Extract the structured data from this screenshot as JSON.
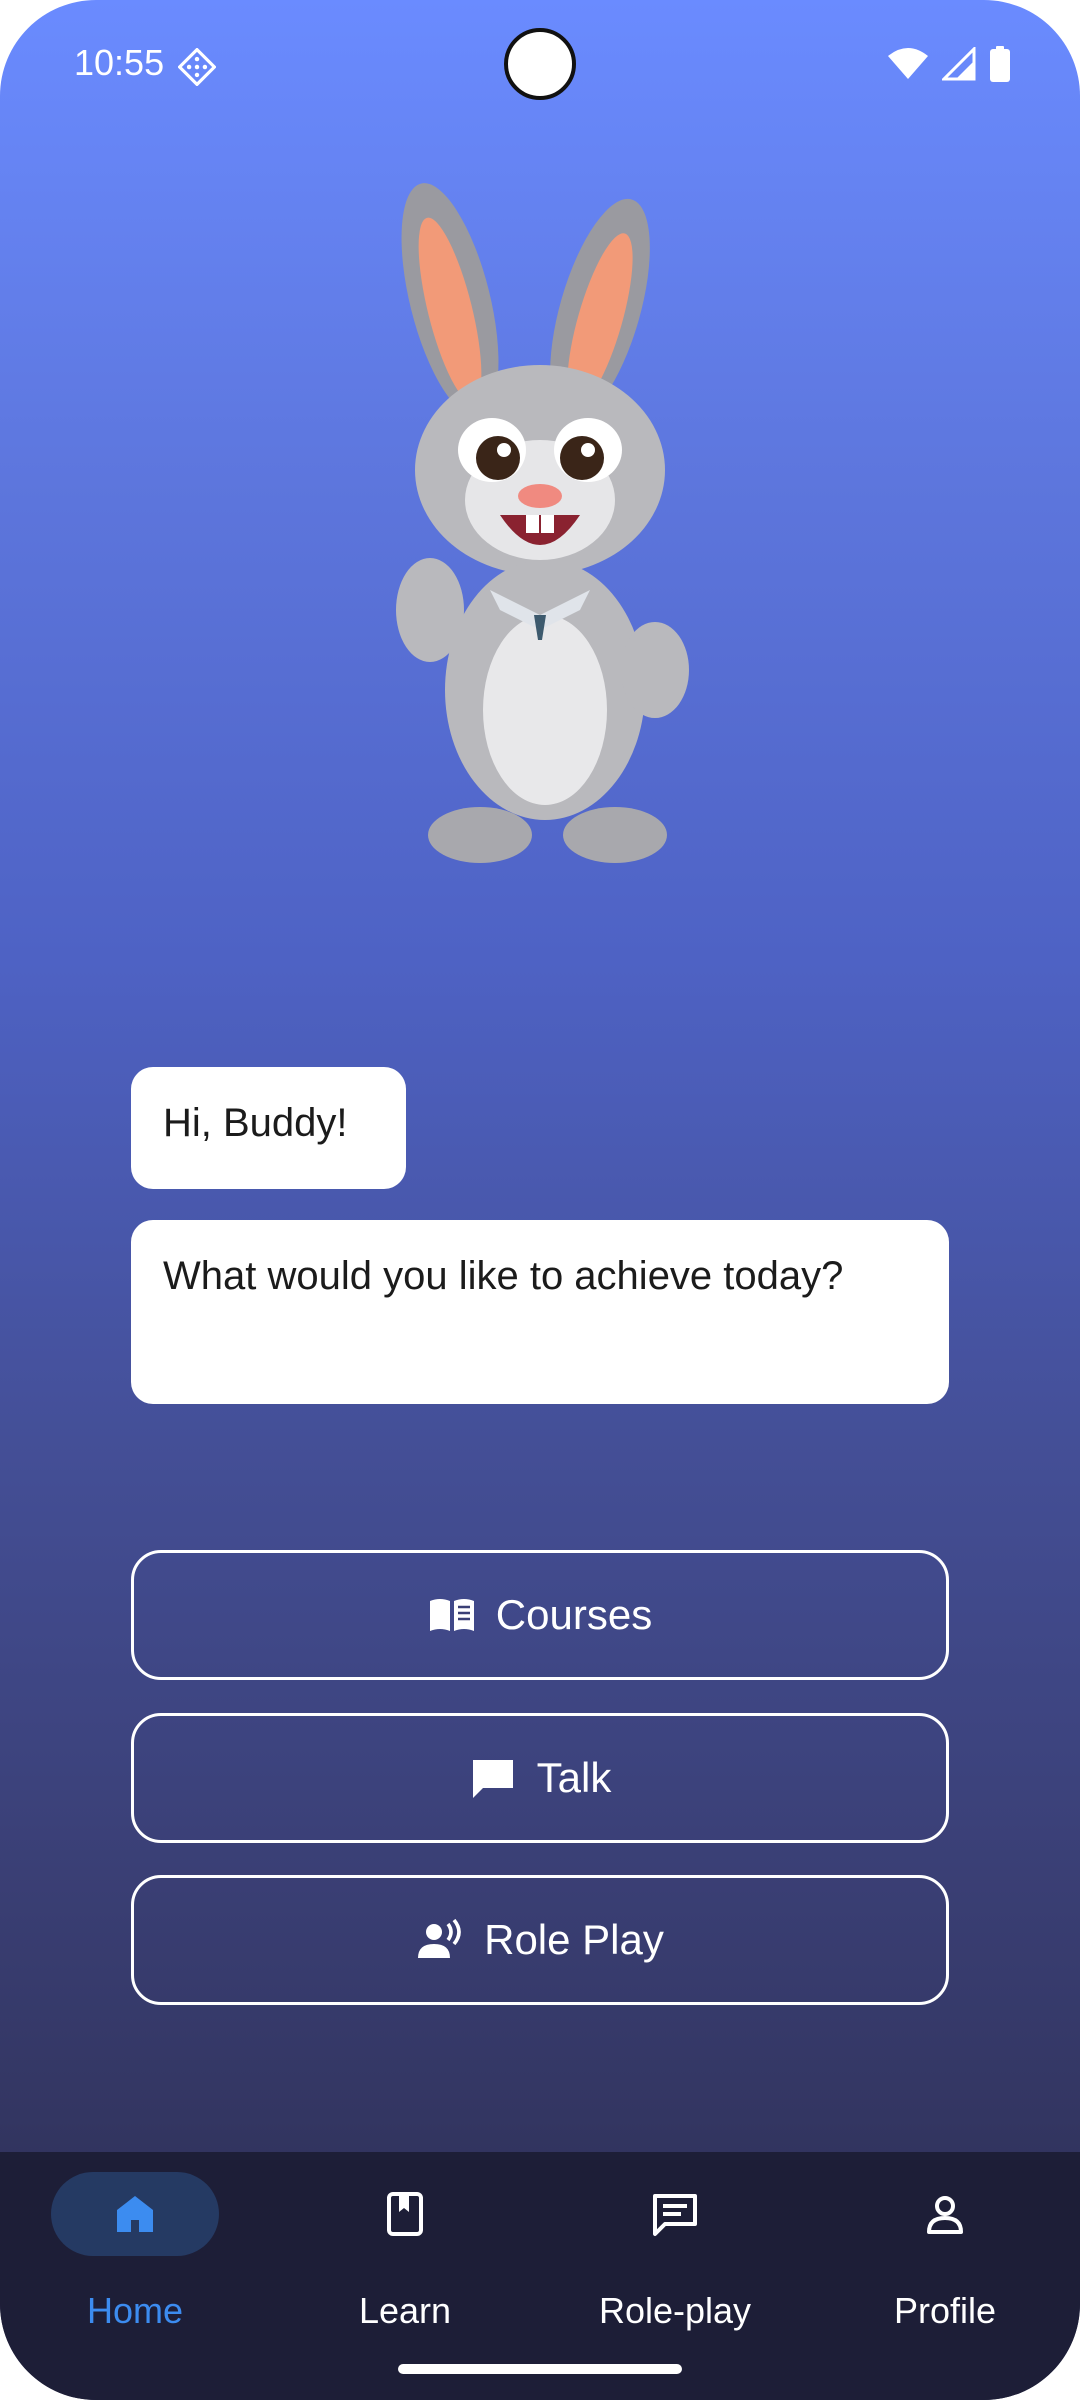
{
  "status_bar": {
    "time": "10:55",
    "app_icon": "diamond-pattern-icon",
    "icons": [
      "wifi-icon",
      "signal-icon",
      "battery-icon"
    ]
  },
  "mascot": {
    "icon": "bunny-mascot-illustration"
  },
  "chat": {
    "greeting": "Hi, Buddy!",
    "question": "What would you like to achieve today?"
  },
  "actions": [
    {
      "label": "Courses",
      "icon": "open-book-icon"
    },
    {
      "label": "Talk",
      "icon": "chat-bubble-icon"
    },
    {
      "label": "Role Play",
      "icon": "speaking-person-icon"
    }
  ],
  "nav": {
    "items": [
      {
        "label": "Home",
        "icon": "home-icon",
        "active": true
      },
      {
        "label": "Learn",
        "icon": "bookmark-book-icon",
        "active": false
      },
      {
        "label": "Role-play",
        "icon": "chat-lines-icon",
        "active": false
      },
      {
        "label": "Profile",
        "icon": "person-icon",
        "active": false
      }
    ]
  },
  "colors": {
    "gradient_top": "#6a8bff",
    "gradient_bottom": "#2b2b4c",
    "nav_background": "#1d1e37",
    "active_accent": "#3c8cf0",
    "active_pill": "#253a63"
  }
}
